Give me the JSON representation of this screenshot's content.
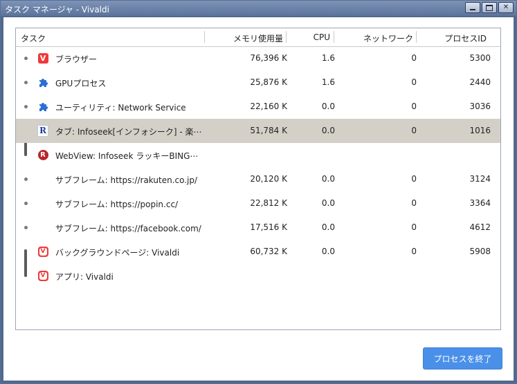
{
  "window": {
    "title": "タスク マネージャ - Vivaldi"
  },
  "table": {
    "headers": {
      "task": "タスク",
      "memory": "メモリ使用量",
      "cpu": "CPU",
      "network": "ネットワーク",
      "pid": "プロセスID"
    },
    "rows": [
      {
        "icon": "vivaldi-icon",
        "task": "ブラウザー",
        "memory": "76,396 K",
        "cpu": "1.6",
        "network": "0",
        "pid": "5300"
      },
      {
        "icon": "puzzle-icon",
        "task": "GPUプロセス",
        "memory": "25,876 K",
        "cpu": "1.6",
        "network": "0",
        "pid": "2440"
      },
      {
        "icon": "puzzle-icon",
        "task": "ユーティリティ: Network Service",
        "memory": "22,160 K",
        "cpu": "0.0",
        "network": "0",
        "pid": "3036"
      },
      {
        "icon": "rakuten-r-icon",
        "task": "タブ: Infoseek[インフォシーク] - 楽⋯",
        "memory": "51,784 K",
        "cpu": "0.0",
        "network": "0",
        "pid": "1016"
      },
      {
        "icon": "rakuten-circle-icon",
        "task": "WebView: Infoseek ラッキーBING⋯",
        "memory": "",
        "cpu": "",
        "network": "",
        "pid": ""
      },
      {
        "icon": "",
        "task": "サブフレーム: https://rakuten.co.jp/",
        "memory": "20,120 K",
        "cpu": "0.0",
        "network": "0",
        "pid": "3124"
      },
      {
        "icon": "",
        "task": "サブフレーム: https://popin.cc/",
        "memory": "22,812 K",
        "cpu": "0.0",
        "network": "0",
        "pid": "3364"
      },
      {
        "icon": "",
        "task": "サブフレーム: https://facebook.com/",
        "memory": "17,516 K",
        "cpu": "0.0",
        "network": "0",
        "pid": "4612"
      },
      {
        "icon": "vivaldi-outline-icon",
        "task": "バックグラウンドページ: Vivaldi",
        "memory": "60,732 K",
        "cpu": "0.0",
        "network": "0",
        "pid": "5908"
      },
      {
        "icon": "vivaldi-outline-icon",
        "task": "アプリ: Vivaldi",
        "memory": "",
        "cpu": "",
        "network": "",
        "pid": ""
      }
    ]
  },
  "end_process_label": "プロセスを終了",
  "colors": {
    "accent": "#4a90e9",
    "selected_row": "#d4d0c8",
    "vivaldi_red": "#ef3939"
  }
}
